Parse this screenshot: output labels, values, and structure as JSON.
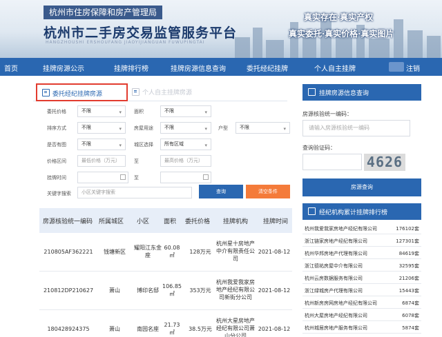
{
  "header": {
    "bureau": "杭州市住房保障和房产管理局",
    "title": "杭州市二手房交易监管服务平台",
    "pinyin": "HANGZHOUSHI   ERSHOUFANG   JIAOYIJIANGUAN   FUWUPINGTAI",
    "slogan1": "真实存在·真实产权",
    "slogan2": "真实委托·真实价格·真实图片"
  },
  "nav": {
    "items": [
      "首页",
      "挂牌房源公示",
      "挂牌排行榜",
      "挂牌房源信息查询",
      "委托经纪挂牌",
      "个人自主挂牌"
    ],
    "logout": "注销"
  },
  "tabs": {
    "agency": "委托经纪挂牌房源",
    "personal": "个人自主挂牌房源"
  },
  "form": {
    "price_label": "委托价格",
    "price_value": "不限",
    "area_label": "面积",
    "area_value": "不限",
    "sort_label": "排序方式",
    "sort_value": "不限",
    "usage_label": "房屋用途",
    "usage_value": "不限",
    "layout_label": "户型",
    "layout_value": "不限",
    "photo_label": "是否有图",
    "photo_value": "不限",
    "district_label": "城区选择",
    "district_value": "所有区域",
    "range_label": "价格区间",
    "min_price_ph": "最低价格（万元）",
    "to1": "至",
    "max_price_ph": "最高价格（万元）",
    "time_label": "挂牌时间",
    "to2": "至",
    "keyword_label": "关键字搜索",
    "keyword_ph": "小区关键字搜索",
    "query_btn": "查询",
    "clear_btn": "清空条件"
  },
  "table": {
    "headers": [
      "房源核验统一编码",
      "所属城区",
      "小区",
      "面积",
      "委托价格",
      "挂牌机构",
      "挂牌时间"
    ],
    "rows": [
      {
        "code": "210805AF362221",
        "district": "钱塘新区",
        "community": "耀阳江东金座",
        "area": "60.08㎡",
        "price": "128万元",
        "agency": "杭州星十房地产中介有限责任公司",
        "date": "2021-08-12"
      },
      {
        "code": "210812DP210627",
        "district": "萧山",
        "community": "博印名邸",
        "area": "106.85㎡",
        "price": "353万元",
        "agency": "杭州我爱我家房地产经纪有限公司新街分公司",
        "date": "2021-08-12"
      },
      {
        "code": "180428924375",
        "district": "萧山",
        "community": "南园名座",
        "area": "21.73㎡",
        "price": "38.5万元",
        "agency": "杭州大星房地产经纪有限公司萧山分公司",
        "date": "2021-08-12"
      }
    ]
  },
  "side": {
    "query_title": "挂牌房源信息查询",
    "code_label": "房源核验统一编码：",
    "code_ph": "请输入房源核验统一编码",
    "captcha_label": "查询验证码：",
    "captcha": "4626",
    "query_btn": "房源查询",
    "rank_title": "经纪机构累计挂牌排行榜",
    "ranks": [
      {
        "name": "杭州我爱我家房地产经纪有限公司",
        "value": "176102套"
      },
      {
        "name": "浙江链家房地产经纪有限公司",
        "value": "127301套"
      },
      {
        "name": "杭州华邦房地产代理有限公司",
        "value": "84619套"
      },
      {
        "name": "浙江德祐房屋中介有限公司",
        "value": "32595套"
      },
      {
        "name": "杭州云房数据服务有限公司",
        "value": "21206套"
      },
      {
        "name": "浙江绿城房产代理有限公司",
        "value": "15443套"
      },
      {
        "name": "杭州新房房网房地产经纪有限公司",
        "value": "6874套"
      },
      {
        "name": "杭州大屋房地产经纪有限公司",
        "value": "6078套"
      },
      {
        "name": "杭州城居房地产服务有限公司",
        "value": "5874套"
      }
    ]
  },
  "colors": {
    "nav": "#2a67b1",
    "highlight": "#e23b2e",
    "clear_btn": "#f47b3a"
  }
}
